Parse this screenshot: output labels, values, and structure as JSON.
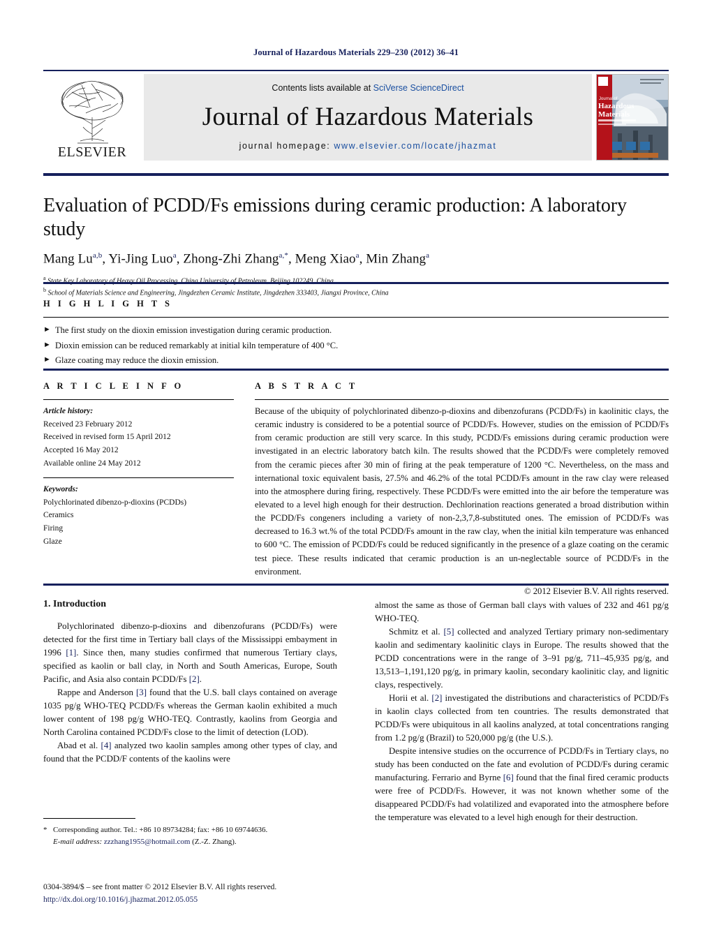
{
  "running_head": "Journal of Hazardous Materials 229–230 (2012) 36–41",
  "masthead": {
    "contents_prefix": "Contents lists available at ",
    "contents_link": "SciVerse ScienceDirect",
    "journal_title": "Journal of Hazardous Materials",
    "homepage_prefix": "journal homepage: ",
    "homepage_link": "www.elsevier.com/locate/jhazmat",
    "publisher_logo": "ELSEVIER",
    "cover_title_line1": "Journal of",
    "cover_title_line2": "Hazardous",
    "cover_title_line3": "Materials"
  },
  "article": {
    "title": "Evaluation of PCDD/Fs emissions during ceramic production: A laboratory study",
    "authors_html": "Mang Lu<sup>a,b</sup>, Yi-Jing Luo<sup>a</sup>, Zhong-Zhi Zhang<sup>a,<span class=\"star\">*</span></sup>, Meng Xiao<sup>a</sup>, Min Zhang<sup>a</sup>",
    "affiliations": [
      "State Key Laboratory of Heavy Oil Processing, China University of Petroleum, Beijing 102249, China",
      "School of Materials Science and Engineering, Jingdezhen Ceramic Institute, Jingdezhen 333403, Jiangxi Province, China"
    ],
    "affiliation_marks": [
      "a",
      "b"
    ]
  },
  "highlights": {
    "heading": "H I G H L I G H T S",
    "bullet_glyph": "►",
    "items": [
      "The first study on the dioxin emission investigation during ceramic production.",
      "Dioxin emission can be reduced remarkably at initial kiln temperature of 400 °C.",
      "Glaze coating may reduce the dioxin emission."
    ]
  },
  "article_info": {
    "heading": "A R T I C L E    I N F O",
    "history_label": "Article history:",
    "history": [
      "Received 23 February 2012",
      "Received in revised form 15 April 2012",
      "Accepted 16 May 2012",
      "Available online 24 May 2012"
    ],
    "keywords_label": "Keywords:",
    "keywords": [
      "Polychlorinated dibenzo-p-dioxins (PCDDs)",
      "Ceramics",
      "Firing",
      "Glaze"
    ]
  },
  "abstract": {
    "heading": "A B S T R A C T",
    "text": "Because of the ubiquity of polychlorinated dibenzo-p-dioxins and dibenzofurans (PCDD/Fs) in kaolinitic clays, the ceramic industry is considered to be a potential source of PCDD/Fs. However, studies on the emission of PCDD/Fs from ceramic production are still very scarce. In this study, PCDD/Fs emissions during ceramic production were investigated in an electric laboratory batch kiln. The results showed that the PCDD/Fs were completely removed from the ceramic pieces after 30 min of firing at the peak temperature of 1200 °C. Nevertheless, on the mass and international toxic equivalent basis, 27.5% and 46.2% of the total PCDD/Fs amount in the raw clay were released into the atmosphere during firing, respectively. These PCDD/Fs were emitted into the air before the temperature was elevated to a level high enough for their destruction. Dechlorination reactions generated a broad distribution within the PCDD/Fs congeners including a variety of non-2,3,7,8-substituted ones. The emission of PCDD/Fs was decreased to 16.3 wt.% of the total PCDD/Fs amount in the raw clay, when the initial kiln temperature was enhanced to 600 °C. The emission of PCDD/Fs could be reduced significantly in the presence of a glaze coating on the ceramic test piece. These results indicated that ceramic production is an un-neglectable source of PCDD/Fs in the environment.",
    "copyright": "© 2012 Elsevier B.V. All rights reserved."
  },
  "introduction": {
    "heading": "1.  Introduction",
    "left_paragraphs": [
      {
        "parts": [
          {
            "t": "Polychlorinated dibenzo-p-dioxins and dibenzofurans (PCDD/Fs) were detected for the first time in Tertiary ball clays of the Mississippi embayment in 1996 "
          },
          {
            "t": "[1]",
            "ref": true
          },
          {
            "t": ". Since then, many studies confirmed that numerous Tertiary clays, specified as kaolin or ball clay, in North and South Americas, Europe, South Pacific, and Asia also contain PCDD/Fs "
          },
          {
            "t": "[2]",
            "ref": true
          },
          {
            "t": "."
          }
        ]
      },
      {
        "parts": [
          {
            "t": "Rappe and Anderson "
          },
          {
            "t": "[3]",
            "ref": true
          },
          {
            "t": " found that the U.S. ball clays contained on average 1035 pg/g WHO-TEQ PCDD/Fs whereas the German kaolin exhibited a much lower content of 198 pg/g WHO-TEQ. Contrastly, kaolins from Georgia and North Carolina contained PCDD/Fs close to the limit of detection (LOD)."
          }
        ]
      },
      {
        "parts": [
          {
            "t": "Abad et al. "
          },
          {
            "t": "[4]",
            "ref": true
          },
          {
            "t": " analyzed two kaolin samples among other types of clay, and found that the PCDD/F contents of the kaolins were"
          }
        ]
      }
    ],
    "right_paragraphs": [
      {
        "continued": true,
        "parts": [
          {
            "t": "almost the same as those of German ball clays with values of 232 and 461 pg/g WHO-TEQ."
          }
        ]
      },
      {
        "parts": [
          {
            "t": "Schmitz et al. "
          },
          {
            "t": "[5]",
            "ref": true
          },
          {
            "t": " collected and analyzed Tertiary primary non-sedimentary kaolin and sedimentary kaolinitic clays in Europe. The results showed that the PCDD concentrations were in the range of 3–91 pg/g, 711–45,935 pg/g, and 13,513–1,191,120 pg/g, in primary kaolin, secondary kaolinitic clay, and lignitic clays, respectively."
          }
        ]
      },
      {
        "parts": [
          {
            "t": "Horii et al. "
          },
          {
            "t": "[2]",
            "ref": true
          },
          {
            "t": " investigated the distributions and characteristics of PCDD/Fs in kaolin clays collected from ten countries. The results demonstrated that PCDD/Fs were ubiquitous in all kaolins analyzed, at total concentrations ranging from 1.2 pg/g (Brazil) to 520,000 pg/g (the U.S.)."
          }
        ]
      },
      {
        "parts": [
          {
            "t": "Despite intensive studies on the occurrence of PCDD/Fs in Tertiary clays, no study has been conducted on the fate and evolution of PCDD/Fs during ceramic manufacturing. Ferrario and Byrne "
          },
          {
            "t": "[6]",
            "ref": true
          },
          {
            "t": " found that the final fired ceramic products were free of PCDD/Fs. However, it was not known whether some of the disappeared PCDD/Fs had volatilized and evaporated into the atmosphere before the temperature was elevated to a level high enough for their destruction."
          }
        ]
      }
    ]
  },
  "footnotes": {
    "corresponding_star": "*",
    "corresponding": "Corresponding author. Tel.: +86 10 89734284; fax: +86 10 69744636.",
    "email_label": "E-mail address:",
    "email": "zzzhang1955@hotmail.com",
    "email_suffix": "(Z.-Z. Zhang).",
    "issn_line": "0304-3894/$ – see front matter © 2012 Elsevier B.V. All rights reserved.",
    "doi": "http://dx.doi.org/10.1016/j.jhazmat.2012.05.055"
  },
  "colors": {
    "rule_navy": "#16205c",
    "link_blue": "#1a4fa0",
    "ref_navy": "#16205c",
    "masthead_gray": "#e9e9e9",
    "elsevier_orange": "#ef7d00"
  }
}
